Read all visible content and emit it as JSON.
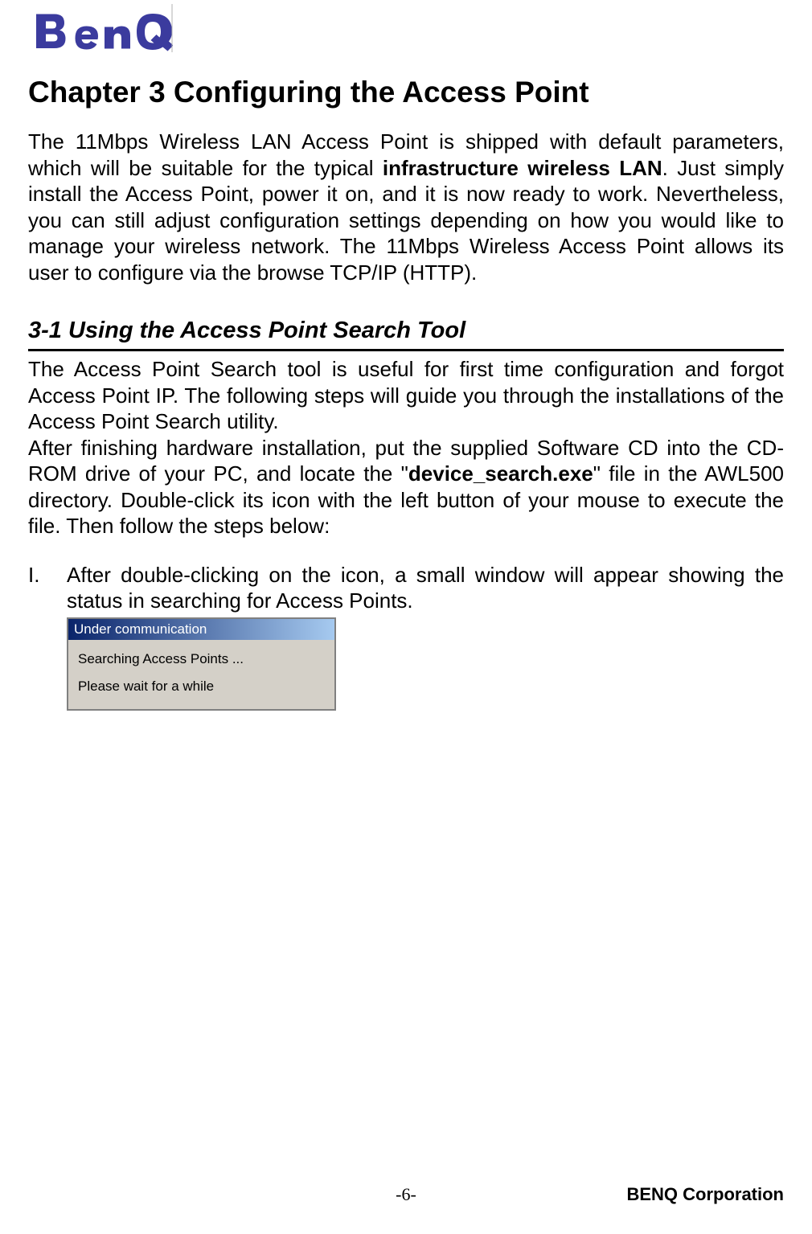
{
  "logo": {
    "brand_name": "BenQ"
  },
  "chapter_title": "Chapter 3 Configuring the Access Point",
  "intro": {
    "part1": "The 11Mbps Wireless LAN Access Point is shipped with default parameters, which will be suitable for the typical ",
    "bold1": "infrastructure wireless LAN",
    "part2": ".  Just simply install the Access Point, power it on, and it is now ready to work. Nevertheless, you can still adjust configuration settings depending on how you would like to manage your wireless network.  The 11Mbps Wireless Access Point allows its user to configure via the browse TCP/IP (HTTP)."
  },
  "section": {
    "heading": "3-1 Using the Access Point Search Tool",
    "para1": "The Access Point Search tool is useful for first time configuration and forgot Access Point IP. The following steps will guide you through the installations of the Access Point Search utility.",
    "para2_part1": "After finishing hardware installation, put the supplied Software CD into the CD-ROM drive of your PC, and locate the \"",
    "para2_bold": "device_search.exe",
    "para2_part2": "\" file in the AWL500 directory. Double-click its icon with the left button of your mouse to execute the file. Then follow the steps below:"
  },
  "list": {
    "marker": "I.",
    "text": "After double-clicking on the icon, a small window will appear showing the status in searching for Access Points."
  },
  "dialog": {
    "title": "Under communication",
    "line1": "Searching Access Points ...",
    "line2": "Please wait for a while"
  },
  "footer": {
    "page": "-6-",
    "company": "BENQ Corporation"
  }
}
